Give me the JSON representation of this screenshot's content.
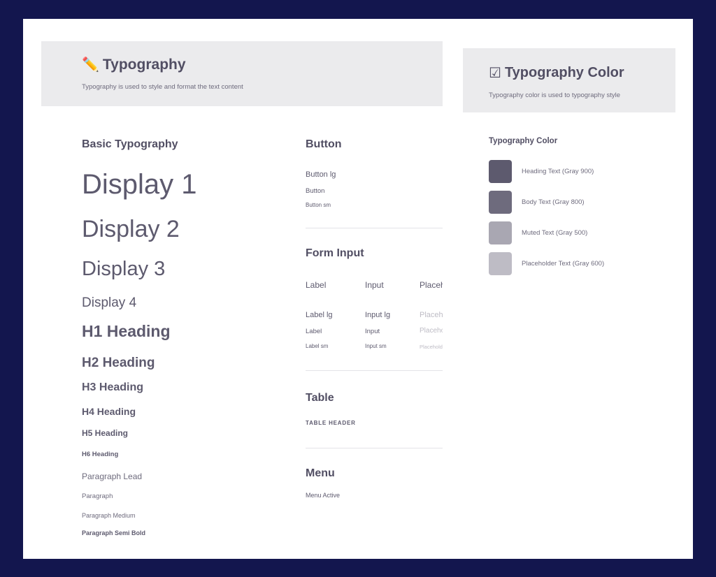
{
  "typography_header": {
    "icon": "pencil-icon",
    "title": "Typography",
    "subtitle": "Typography is used to style and format the text content"
  },
  "color_header": {
    "icon": "checkbox-icon",
    "title": "Typography Color",
    "subtitle": "Typography color is used to typography style"
  },
  "basic_typography": {
    "title": "Basic Typography",
    "display1": "Display 1",
    "display2": "Display 2",
    "display3": "Display 3",
    "display4": "Display 4",
    "h1": "H1 Heading",
    "h2": "H2 Heading",
    "h3": "H3 Heading",
    "h4": "H4 Heading",
    "h5": "H5 Heading",
    "h6": "H6 Heading",
    "paragraph_lead": "Paragraph Lead",
    "paragraph": "Paragraph",
    "paragraph_medium": "Paragraph Medium",
    "paragraph_semibold": "Paragraph Semi Bold"
  },
  "button_section": {
    "title": "Button",
    "lg": "Button lg",
    "md": "Button",
    "sm": "Button sm"
  },
  "form_input_section": {
    "title": "Form Input",
    "headers": [
      "Label",
      "Input",
      "Placeholder"
    ],
    "rows": [
      [
        "Label lg",
        "Input lg",
        "Placeholder lg"
      ],
      [
        "Label",
        "Input",
        "Placeholder"
      ],
      [
        "Label sm",
        "Input sm",
        "Placeholder sm"
      ]
    ]
  },
  "table_section": {
    "title": "Table",
    "header": "TABLE HEADER"
  },
  "menu_section": {
    "title": "Menu",
    "active": "Menu Active"
  },
  "typography_color": {
    "title": "Typography Color",
    "items": [
      {
        "label": "Heading Text (Gray 900)",
        "color": "#5d5a6e"
      },
      {
        "label": "Body Text (Gray 800)",
        "color": "#6e6b7d"
      },
      {
        "label": "Muted Text (Gray 500)",
        "color": "#a9a7b2"
      },
      {
        "label": "Placeholder Text (Gray 600)",
        "color": "#bebcc5"
      }
    ]
  }
}
